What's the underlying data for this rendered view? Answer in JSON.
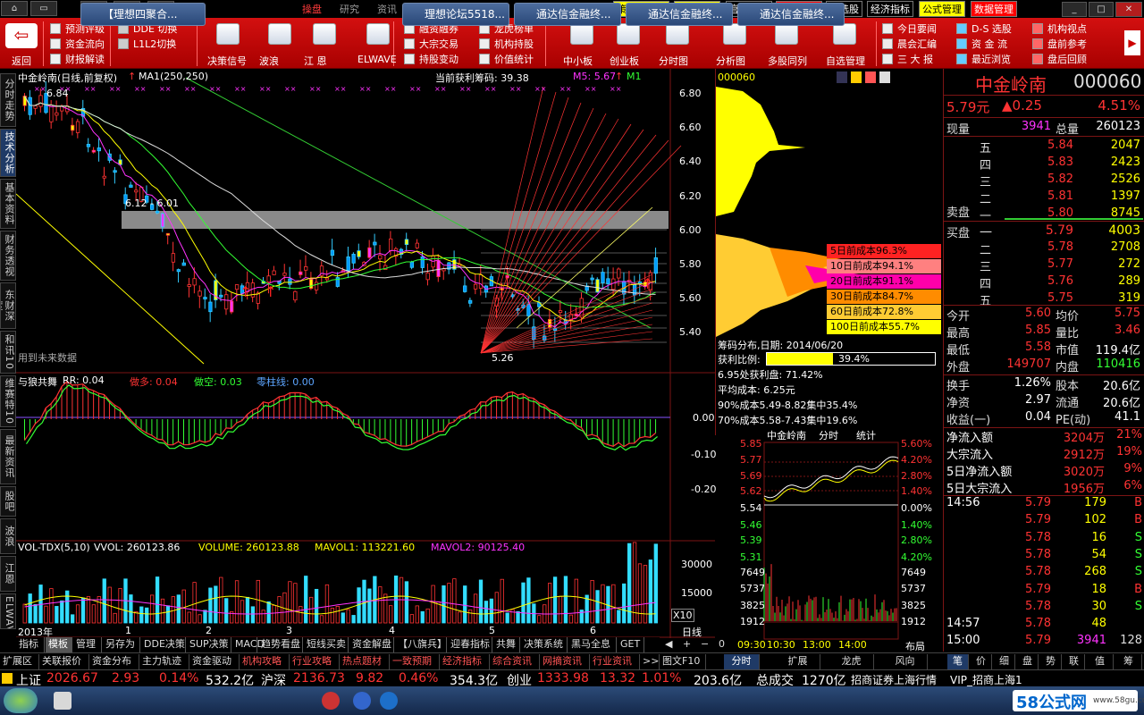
{
  "window": {
    "title": "通达信金融终端"
  },
  "nav": {
    "back": "◀",
    "fwd": "▶",
    "up": "▲"
  },
  "menu": [
    "操盘",
    "研究",
    "资讯",
    "特色",
    "官方",
    "平安",
    "分类",
    "系统"
  ],
  "right_menu": [
    {
      "label": "策略股股池",
      "bg": "#ffff00",
      "fg": "#000"
    },
    {
      "label": "交易登陆",
      "bg": "#ffff00",
      "fg": "#000"
    },
    {
      "label": "官方资讯",
      "bg": "#000",
      "fg": "#fff"
    },
    {
      "label": "沪深行情",
      "bg": "#ff0000",
      "fg": "#fff"
    },
    {
      "label": "自选股",
      "bg": "#000",
      "fg": "#fff"
    },
    {
      "label": "经济指标",
      "bg": "#000",
      "fg": "#fff"
    },
    {
      "label": "公式管理",
      "bg": "#ffff00",
      "fg": "#000"
    },
    {
      "label": "数据管理",
      "bg": "#ff0000",
      "fg": "#fff"
    }
  ],
  "toolbar": {
    "back": "返回",
    "g1": [
      "预测评级",
      "资金流向",
      "财报解读"
    ],
    "g2": [
      "DDE 切换",
      "L1L2切换"
    ],
    "big1": [
      "决策信号",
      "波浪",
      "江 恩",
      "ELWAVE"
    ],
    "g3": [
      "融资融券",
      "大宗交易",
      "持股变动"
    ],
    "g4": [
      "龙虎榜单",
      "机构持股",
      "价值统计"
    ],
    "big2": [
      "中小板",
      "创业板",
      "分时图",
      "分析图",
      "多股同列",
      "自选管理"
    ],
    "g5": [
      "今日要闻",
      "晨会汇编",
      "三 大 报"
    ],
    "g6": [
      "D-S 选股",
      "资 金 流",
      "最近浏览"
    ],
    "g7": [
      "机构视点",
      "盘前参考",
      "盘后回顾"
    ]
  },
  "side_tabs": [
    "分时走势",
    "技术分析",
    "基本资料",
    "财务透视",
    "东财深度",
    "和讯10",
    "维赛特10",
    "最新资讯",
    "股吧",
    "波浪",
    "江恩",
    "ELWAVE"
  ],
  "main_chart": {
    "title": "中金岭南(日线,前复权)",
    "ma_label": "MA1(250,250)",
    "profit_label": "当前获利筹码: 39.38",
    "m5": "M5: 5.67",
    "m1": "M1",
    "high_label": "6.84",
    "range_label": "6.12 - 6.01",
    "low_label": "5.26",
    "future_note": "用到未来数据",
    "y_ticks": [
      "6.80",
      "6.60",
      "6.40",
      "6.20",
      "6.00",
      "5.80",
      "5.60",
      "5.40"
    ],
    "y_values": [
      6.8,
      6.6,
      6.4,
      6.2,
      6.0,
      5.8,
      5.6,
      5.4
    ],
    "ylim": [
      5.2,
      6.9
    ]
  },
  "indicator": {
    "name": "与狼共舞",
    "rr": "RR: 0.04",
    "buy": "做多: 0.04",
    "sell": "做空: 0.03",
    "zero": "零柱线: 0.00",
    "y_ticks": [
      "0.00",
      "-0.10",
      "-0.20"
    ]
  },
  "volume": {
    "name": "VOL-TDX(5,10)",
    "vol": "VVOL: 260123.86",
    "volume": "VOLUME: 260123.88",
    "mavol1": "MAVOL1: 113221.60",
    "mavol2": "MAVOL2: 90125.40",
    "y_ticks": [
      "30000",
      "15000"
    ],
    "unit": "X10",
    "x_labels": [
      "2013年",
      "1",
      "2",
      "3",
      "4",
      "5",
      "6"
    ]
  },
  "chips": {
    "code": "000060",
    "date": "筹码分布,日期: 2014/06/20",
    "profit_ratio_label": "获利比例:",
    "profit_ratio": "39.4%",
    "rows": [
      {
        "label": "5日前成本96.3%",
        "bg": "#ff2222"
      },
      {
        "label": "10日前成本94.1%",
        "bg": "#ff8080"
      },
      {
        "label": "20日前成本91.1%",
        "bg": "#ff00aa"
      },
      {
        "label": "30日前成本84.7%",
        "bg": "#ff8c00"
      },
      {
        "label": "60日前成本72.8%",
        "bg": "#ffcc33"
      },
      {
        "label": "100日前成本55.7%",
        "bg": "#ffff00"
      }
    ],
    "stats": [
      "6.95处获利盘: 71.42%",
      "平均成本: 6.25元",
      "90%成本5.49-8.82集中35.4%",
      "70%成本5.58-7.43集中19.6%"
    ]
  },
  "mini": {
    "title": "中金岭南",
    "tab1": "分时",
    "tab2": "统计",
    "left": [
      "5.85",
      "5.77",
      "5.69",
      "5.62",
      "5.54",
      "5.46",
      "5.39",
      "5.31",
      "7649",
      "5737",
      "3825",
      "1912"
    ],
    "right": [
      "5.60%",
      "4.20%",
      "2.80%",
      "1.40%",
      "0.00%",
      "1.40%",
      "2.80%",
      "4.20%",
      "7649",
      "5737",
      "3825",
      "1912"
    ],
    "times": [
      "09:30",
      "10:30",
      "13:00",
      "14:00"
    ],
    "day_label": "日线",
    "layout_label": "布局"
  },
  "quote": {
    "name": "中金岭南",
    "code": "000060",
    "price": "5.79元",
    "change": "▲0.25",
    "pct": "4.51%",
    "now_label": "现量",
    "now": "3941",
    "total_label": "总量",
    "total": "260123",
    "sells": [
      [
        "五",
        "5.84",
        "2047"
      ],
      [
        "四",
        "5.83",
        "2423"
      ],
      [
        "三",
        "5.82",
        "2526"
      ],
      [
        "二",
        "5.81",
        "1397"
      ],
      [
        "一",
        "5.80",
        "8745"
      ]
    ],
    "sell_label": "卖盘",
    "buy_label": "买盘",
    "buys": [
      [
        "一",
        "5.79",
        "4003"
      ],
      [
        "二",
        "5.78",
        "2708"
      ],
      [
        "三",
        "5.77",
        "272"
      ],
      [
        "四",
        "5.76",
        "289"
      ],
      [
        "五",
        "5.75",
        "319"
      ]
    ],
    "stats1": [
      [
        "今开",
        "5.60",
        "均价",
        "5.75"
      ],
      [
        "最高",
        "5.85",
        "量比",
        "3.46"
      ],
      [
        "最低",
        "5.58",
        "市值",
        "119.4亿"
      ],
      [
        "外盘",
        "149707",
        "内盘",
        "110416"
      ]
    ],
    "stats2": [
      [
        "换手",
        "1.26%",
        "股本",
        "20.6亿"
      ],
      [
        "净资",
        "2.97",
        "流通",
        "20.6亿"
      ],
      [
        "收益(一)",
        "0.04",
        "PE(动)",
        "41.1"
      ]
    ],
    "flows": [
      [
        "净流入额",
        "3204万",
        "21%"
      ],
      [
        "大宗流入",
        "2912万",
        "19%"
      ],
      [
        "5日净流入额",
        "3020万",
        "9%"
      ],
      [
        "5日大宗流入",
        "1956万",
        "6%"
      ]
    ],
    "ticks": [
      [
        "14:56",
        "5.79",
        "179",
        "B"
      ],
      [
        "",
        "5.79",
        "102",
        "B"
      ],
      [
        "",
        "5.78",
        "16",
        "S"
      ],
      [
        "",
        "5.78",
        "54",
        "S"
      ],
      [
        "",
        "5.78",
        "268",
        "S"
      ],
      [
        "",
        "5.79",
        "18",
        "B"
      ],
      [
        "",
        "5.78",
        "30",
        "S"
      ],
      [
        "14:57",
        "5.78",
        "48",
        ""
      ],
      [
        "15:00",
        "5.79",
        "3941",
        "128"
      ]
    ]
  },
  "bottom_tabs1": [
    "指标",
    "模板",
    "管理",
    "另存为",
    "DDE决策",
    "SUP决策",
    "MACD",
    "趋势看盘",
    "短线买卖",
    "资金解盘",
    "【八旗兵】",
    "迎春指标",
    "共舞",
    "决策系统",
    "黑马全息",
    "GET"
  ],
  "bottom_tabs2": [
    "扩展区",
    "关联报价",
    "资金分布",
    "主力轨迹",
    "资金驱动",
    "机构攻略",
    "行业攻略",
    "热点题材",
    "一致预期",
    "经济指标",
    "综合资讯",
    "网摘资讯",
    "行业资讯",
    ">>",
    "图文F10"
  ],
  "bottom_right_tabs": [
    "分时",
    "扩展",
    "龙虎",
    "风向",
    "笔",
    "价",
    "细",
    "盘",
    "势",
    "联",
    "值",
    "筹"
  ],
  "status": {
    "sh_label": "上证",
    "sh": "2026.67",
    "sh_chg": "2.93",
    "sh_pct": "0.14%",
    "sh_amt": "532.2亿",
    "hs_label": "沪深",
    "hs": "2136.73",
    "hs_chg": "9.82",
    "hs_pct": "0.46%",
    "hs_amt": "354.3亿",
    "cy_label": "创业",
    "cy": "1333.98",
    "cy_chg": "13.32",
    "cy_pct": "1.01%",
    "cy_amt": "203.6亿",
    "total_label": "总成交",
    "total": "1270亿",
    "broker": "招商证券上海行情",
    "vip": "VIP_招商上海1"
  },
  "taskbar": [
    "【理想四聚合...",
    "理想论坛5518...",
    "通达信金融终...",
    "通达信金融终...",
    "通达信金融终..."
  ],
  "watermark": "58公式网",
  "watermark_url": "www.58gu.com"
}
